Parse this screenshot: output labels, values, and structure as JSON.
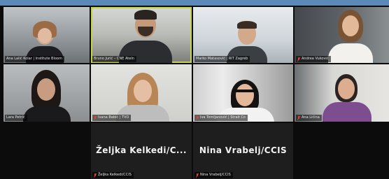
{
  "participants": [
    {
      "name": "Ana Lalić Kolar | Institute Bloom",
      "muted": false,
      "video": true,
      "speaking": false
    },
    {
      "name": "Bruno Jurić – CNE Ateln",
      "muted": false,
      "video": true,
      "speaking": true
    },
    {
      "name": "Marko Matasović | RIT Zagreb",
      "muted": false,
      "video": true,
      "speaking": false
    },
    {
      "name": "Andrea Vuković",
      "muted": true,
      "video": true,
      "speaking": false
    },
    {
      "name": "Lara Petrić",
      "muted": false,
      "video": true,
      "speaking": false
    },
    {
      "name": "Ivana Babić | TVO",
      "muted": true,
      "video": true,
      "speaking": false
    },
    {
      "name": "Iva Tomljanović | Strait Co",
      "muted": true,
      "video": true,
      "speaking": false
    },
    {
      "name": "Ana Ličina",
      "muted": true,
      "video": true,
      "speaking": false
    },
    {
      "name": "Željka Kelkedi/CCIS",
      "display": "Željka  Kelkedi/C...",
      "muted": true,
      "video": false,
      "speaking": false
    },
    {
      "name": "Nina Vrabelj/CCIS",
      "display": "Nina Vrabelj/CCIS",
      "muted": true,
      "video": false,
      "speaking": false
    }
  ],
  "colors": {
    "speaking_border": "#c6d24a",
    "mic_muted": "#e0463c",
    "top_bar": "#5b8ab8"
  }
}
